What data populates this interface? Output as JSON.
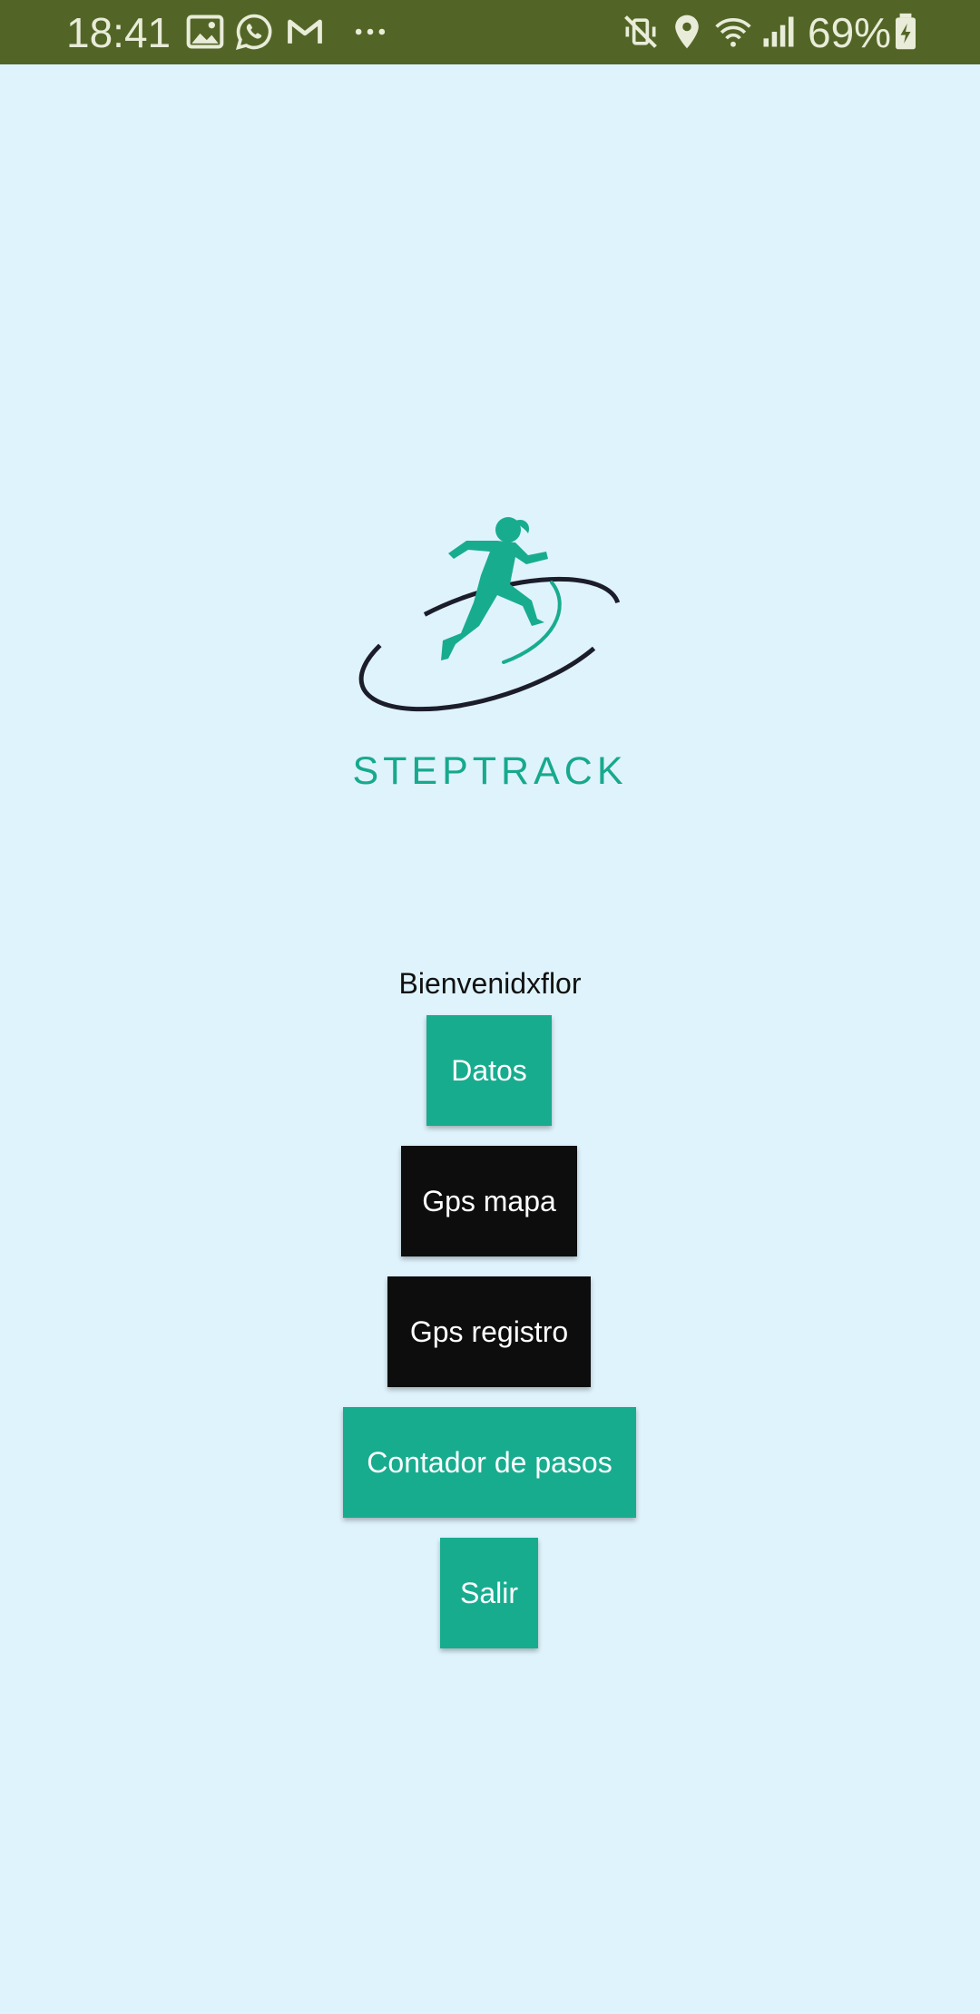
{
  "status_bar": {
    "time": "18:41",
    "battery": "69%",
    "left_icons": [
      "gallery-icon",
      "whatsapp-icon",
      "gmail-icon",
      "more-dots-icon"
    ],
    "right_icons": [
      "mute-vibrate-icon",
      "location-icon",
      "wifi-icon",
      "signal-icon",
      "battery-charging-icon"
    ],
    "background_color": "#526526"
  },
  "app": {
    "background_color": "#dff3fc",
    "brand_name": "STEPTRACK",
    "logo_icon": "runner-logo-icon",
    "welcome_text": "Bienvenidxflor",
    "accent_color": "#18ac8f",
    "dark_color": "#0d0d0e"
  },
  "buttons": {
    "datos": "Datos",
    "gps_mapa": "Gps mapa",
    "gps_registro": "Gps registro",
    "contador": "Contador de pasos",
    "salir": "Salir"
  }
}
